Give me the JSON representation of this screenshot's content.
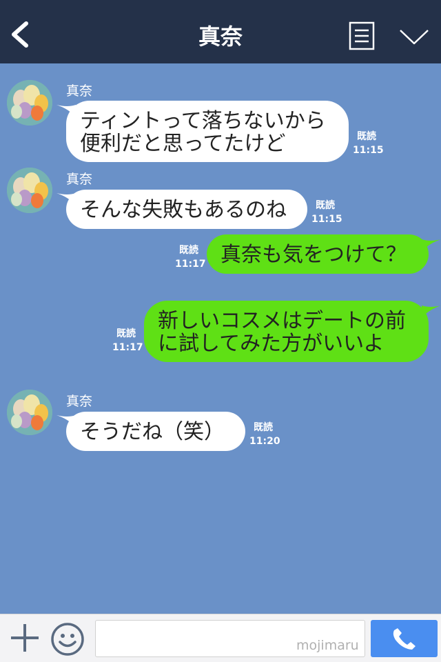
{
  "header": {
    "title": "真奈",
    "back_icon": "chevron-left-icon",
    "menu_icon": "notes-icon",
    "collapse_icon": "chevron-down-icon"
  },
  "messages": [
    {
      "side": "left",
      "name": "真奈",
      "lines": [
        "ティントって落ちないから",
        "便利だと思ってたけど"
      ],
      "read": "既読",
      "time": "11:15"
    },
    {
      "side": "left",
      "name": "真奈",
      "lines": [
        "そんな失敗もあるのね"
      ],
      "read": "既読",
      "time": "11:15"
    },
    {
      "side": "right",
      "lines": [
        "真奈も気をつけて？"
      ],
      "read": "既読",
      "time": "11:17"
    },
    {
      "side": "right",
      "lines": [
        "新しいコスメはデートの前",
        "に試してみた方がいいよ"
      ],
      "read": "既読",
      "time": "11:17"
    },
    {
      "side": "left",
      "name": "真奈",
      "lines": [
        "そうだね（笑）"
      ],
      "read": "既読",
      "time": "11:20"
    }
  ],
  "footer": {
    "plus_icon": "plus-icon",
    "emoji_icon": "smiley-icon",
    "input_value": "",
    "watermark": "mojimaru",
    "call_icon": "phone-icon"
  },
  "colors": {
    "header_bg": "#243149",
    "chat_bg": "#6a91c8",
    "my_bubble": "#5fe015",
    "their_bubble": "#ffffff",
    "call_button": "#4a8ef0"
  }
}
